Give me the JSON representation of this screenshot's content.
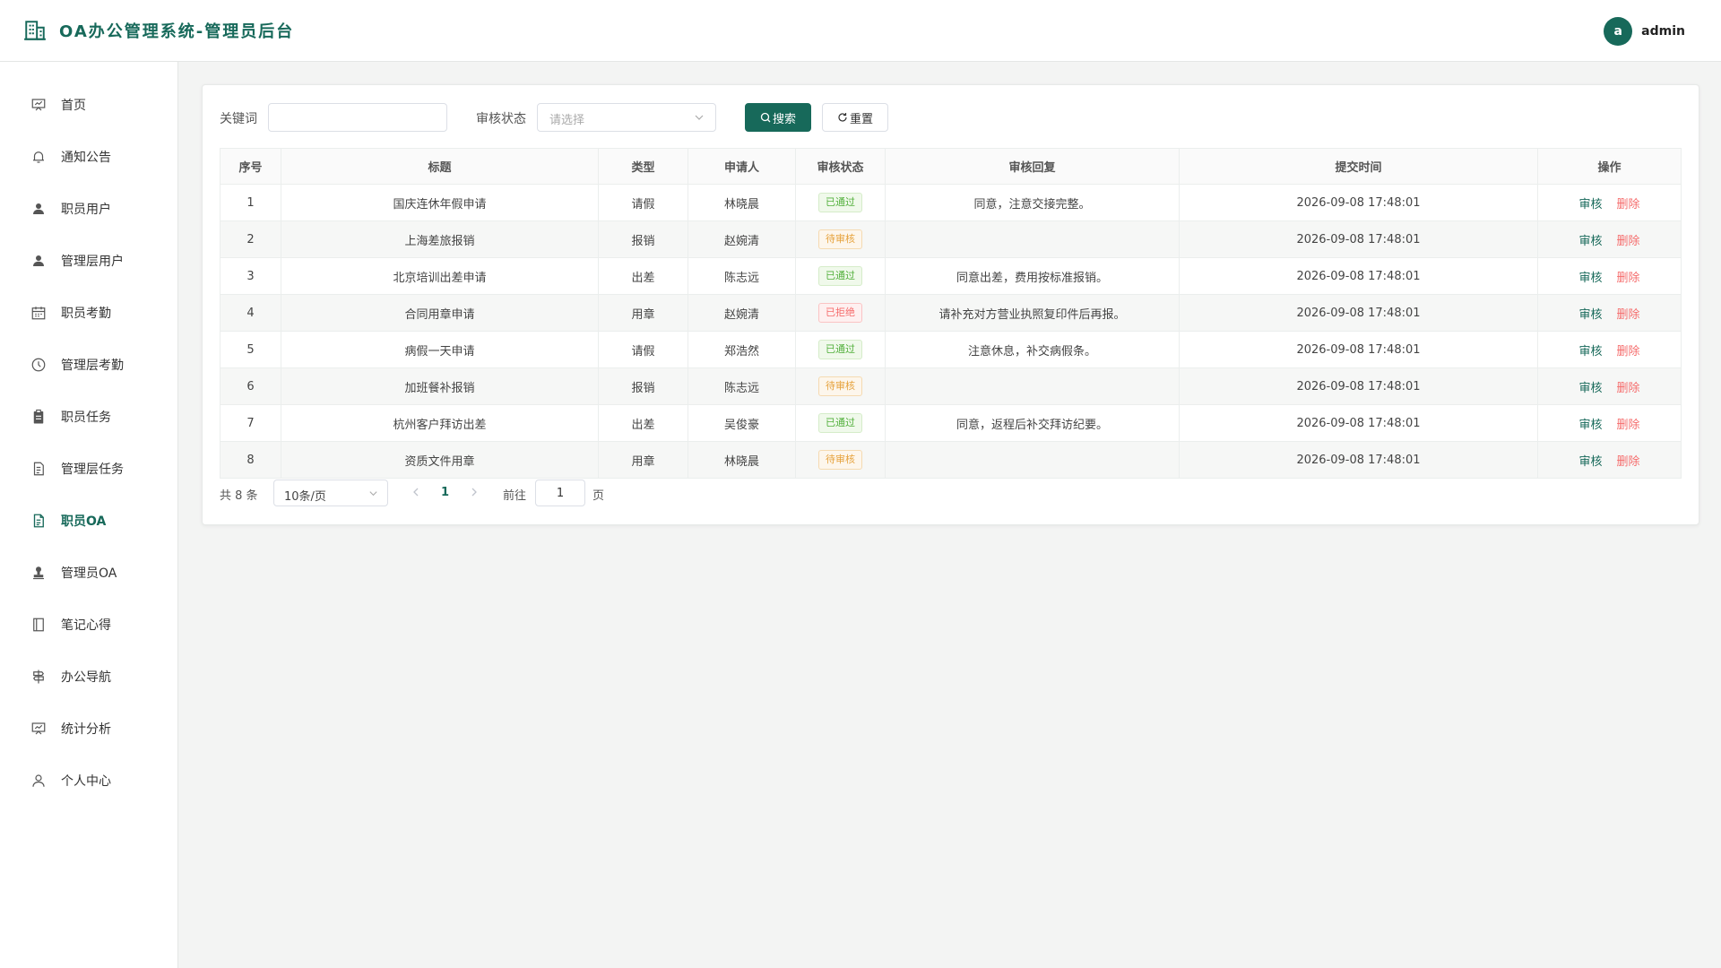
{
  "header": {
    "title": "OA办公管理系统-管理员后台",
    "avatar_letter": "a",
    "username": "admin"
  },
  "sidebar": {
    "items": [
      {
        "label": "首页",
        "icon": "home-icon"
      },
      {
        "label": "通知公告",
        "icon": "bell-icon"
      },
      {
        "label": "职员用户",
        "icon": "user-icon"
      },
      {
        "label": "管理层用户",
        "icon": "user-icon"
      },
      {
        "label": "职员考勤",
        "icon": "calendar-icon"
      },
      {
        "label": "管理层考勤",
        "icon": "clock-icon"
      },
      {
        "label": "职员任务",
        "icon": "clipboard-icon"
      },
      {
        "label": "管理层任务",
        "icon": "document-icon"
      },
      {
        "label": "职员OA",
        "icon": "document-icon",
        "active": true
      },
      {
        "label": "管理员OA",
        "icon": "stamp-icon"
      },
      {
        "label": "笔记心得",
        "icon": "notebook-icon"
      },
      {
        "label": "办公导航",
        "icon": "signpost-icon"
      },
      {
        "label": "统计分析",
        "icon": "chart-icon"
      },
      {
        "label": "个人中心",
        "icon": "user-icon"
      }
    ]
  },
  "filters": {
    "keyword_label": "关键词",
    "keyword_value": "",
    "status_label": "审核状态",
    "status_placeholder": "请选择",
    "search_label": "搜索",
    "reset_label": "重置"
  },
  "table": {
    "columns": [
      "序号",
      "标题",
      "类型",
      "申请人",
      "审核状态",
      "审核回复",
      "提交时间",
      "操作"
    ],
    "rows": [
      {
        "no": "1",
        "title": "国庆连休年假申请",
        "type": "请假",
        "applicant": "林晓晨",
        "status": "已通过",
        "status_kind": "approved",
        "reply": "同意，注意交接完整。",
        "time": "2026-09-08 17:48:01"
      },
      {
        "no": "2",
        "title": "上海差旅报销",
        "type": "报销",
        "applicant": "赵婉清",
        "status": "待审核",
        "status_kind": "pending",
        "reply": "",
        "time": "2026-09-08 17:48:01"
      },
      {
        "no": "3",
        "title": "北京培训出差申请",
        "type": "出差",
        "applicant": "陈志远",
        "status": "已通过",
        "status_kind": "approved",
        "reply": "同意出差，费用按标准报销。",
        "time": "2026-09-08 17:48:01"
      },
      {
        "no": "4",
        "title": "合同用章申请",
        "type": "用章",
        "applicant": "赵婉清",
        "status": "已拒绝",
        "status_kind": "rejected",
        "reply": "请补充对方营业执照复印件后再报。",
        "time": "2026-09-08 17:48:01"
      },
      {
        "no": "5",
        "title": "病假一天申请",
        "type": "请假",
        "applicant": "郑浩然",
        "status": "已通过",
        "status_kind": "approved",
        "reply": "注意休息，补交病假条。",
        "time": "2026-09-08 17:48:01"
      },
      {
        "no": "6",
        "title": "加班餐补报销",
        "type": "报销",
        "applicant": "陈志远",
        "status": "待审核",
        "status_kind": "pending",
        "reply": "",
        "time": "2026-09-08 17:48:01"
      },
      {
        "no": "7",
        "title": "杭州客户拜访出差",
        "type": "出差",
        "applicant": "吴俊豪",
        "status": "已通过",
        "status_kind": "approved",
        "reply": "同意，返程后补交拜访纪要。",
        "time": "2026-09-08 17:48:01"
      },
      {
        "no": "8",
        "title": "资质文件用章",
        "type": "用章",
        "applicant": "林晓晨",
        "status": "待审核",
        "status_kind": "pending",
        "reply": "",
        "time": "2026-09-08 17:48:01"
      }
    ],
    "audit_label": "审核",
    "delete_label": "删除"
  },
  "pagination": {
    "total": "共 8 条",
    "page_size": "10条/页",
    "current_page": "1",
    "goto_label": "前往",
    "goto_value": "1",
    "page_suffix": "页"
  },
  "colors": {
    "primary": "#17695a",
    "danger": "#f56c6c",
    "approved": "#52b03c",
    "pending": "#e6a23c"
  }
}
